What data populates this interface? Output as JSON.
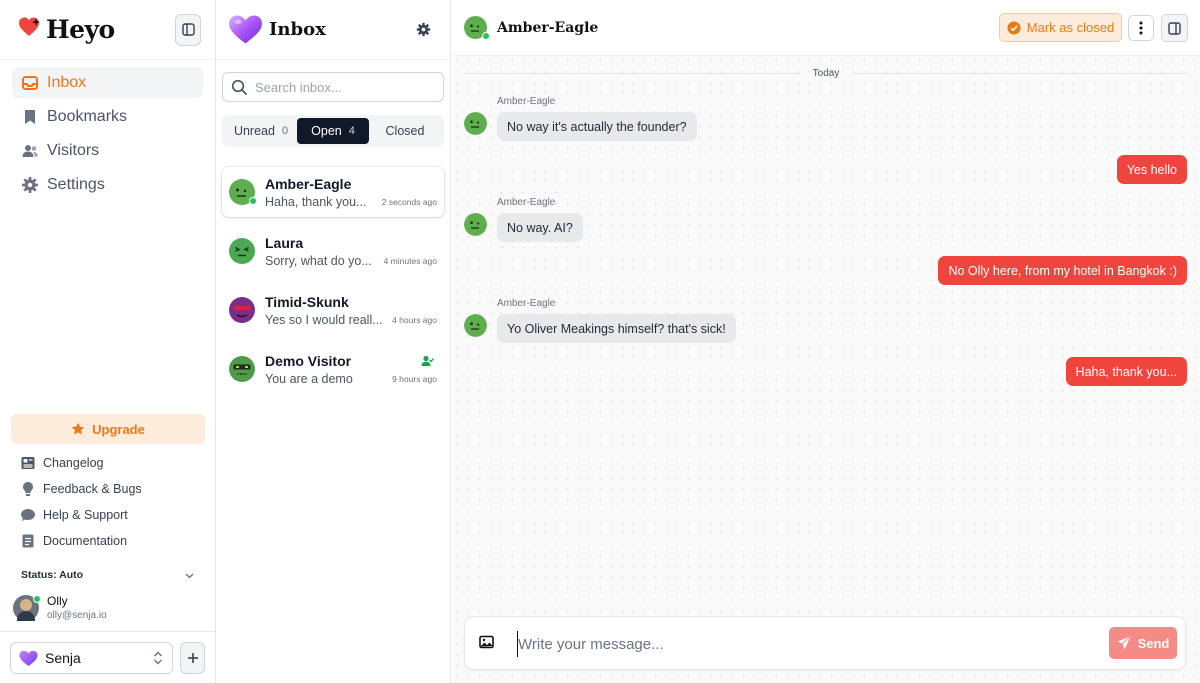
{
  "colors": {
    "accent": "#f97316",
    "outgoing_bubble": "#f0453f",
    "incoming_bubble": "#e8e9eb",
    "online": "#22c55e",
    "tab_active": "#111827"
  },
  "sidebar": {
    "brand": "Heyo",
    "nav": [
      {
        "label": "Inbox",
        "icon": "inbox-icon",
        "active": true
      },
      {
        "label": "Bookmarks",
        "icon": "bookmark-icon"
      },
      {
        "label": "Visitors",
        "icon": "users-icon"
      },
      {
        "label": "Settings",
        "icon": "gear-icon"
      }
    ],
    "upgrade_label": "Upgrade",
    "links": [
      {
        "label": "Changelog",
        "icon": "newspaper-icon"
      },
      {
        "label": "Feedback & Bugs",
        "icon": "lightbulb-icon"
      },
      {
        "label": "Help & Support",
        "icon": "chat-bubble-icon"
      },
      {
        "label": "Documentation",
        "icon": "document-icon"
      }
    ],
    "status_label": "Status: Auto",
    "user": {
      "name": "Olly",
      "email": "olly@senja.io"
    },
    "workspace": "Senja"
  },
  "inbox": {
    "title": "Inbox",
    "search_placeholder": "Search inbox...",
    "tabs": [
      {
        "label": "Unread",
        "count": "0"
      },
      {
        "label": "Open",
        "count": "4",
        "active": true
      },
      {
        "label": "Closed",
        "count": ""
      }
    ],
    "conversations": [
      {
        "name": "Amber-Eagle",
        "preview": "Haha, thank you...",
        "time": "2 seconds ago",
        "online": true,
        "active": true
      },
      {
        "name": "Laura",
        "preview": "Sorry, what do yo...",
        "time": "4 minutes ago"
      },
      {
        "name": "Timid-Skunk",
        "preview": "Yes so I would reall...",
        "time": "4 hours ago"
      },
      {
        "name": "Demo Visitor",
        "preview": "You are a demo",
        "time": "9 hours ago",
        "assigned": true
      }
    ]
  },
  "chat": {
    "title": "Amber-Eagle",
    "mark_closed_label": "Mark as closed",
    "day_separator": "Today",
    "messages": [
      {
        "dir": "in",
        "sender": "Amber-Eagle",
        "text": "No way it's actually the founder?"
      },
      {
        "dir": "out",
        "text": "Yes hello"
      },
      {
        "dir": "in",
        "sender": "Amber-Eagle",
        "text": "No way. AI?"
      },
      {
        "dir": "out",
        "text": "No Olly here, from my hotel in Bangkok :)"
      },
      {
        "dir": "in",
        "sender": "Amber-Eagle",
        "text": "Yo Oliver Meakings himself? that's sick!"
      },
      {
        "dir": "out",
        "text": "Haha, thank you..."
      }
    ],
    "composer_placeholder": "Write your message...",
    "send_label": "Send"
  }
}
